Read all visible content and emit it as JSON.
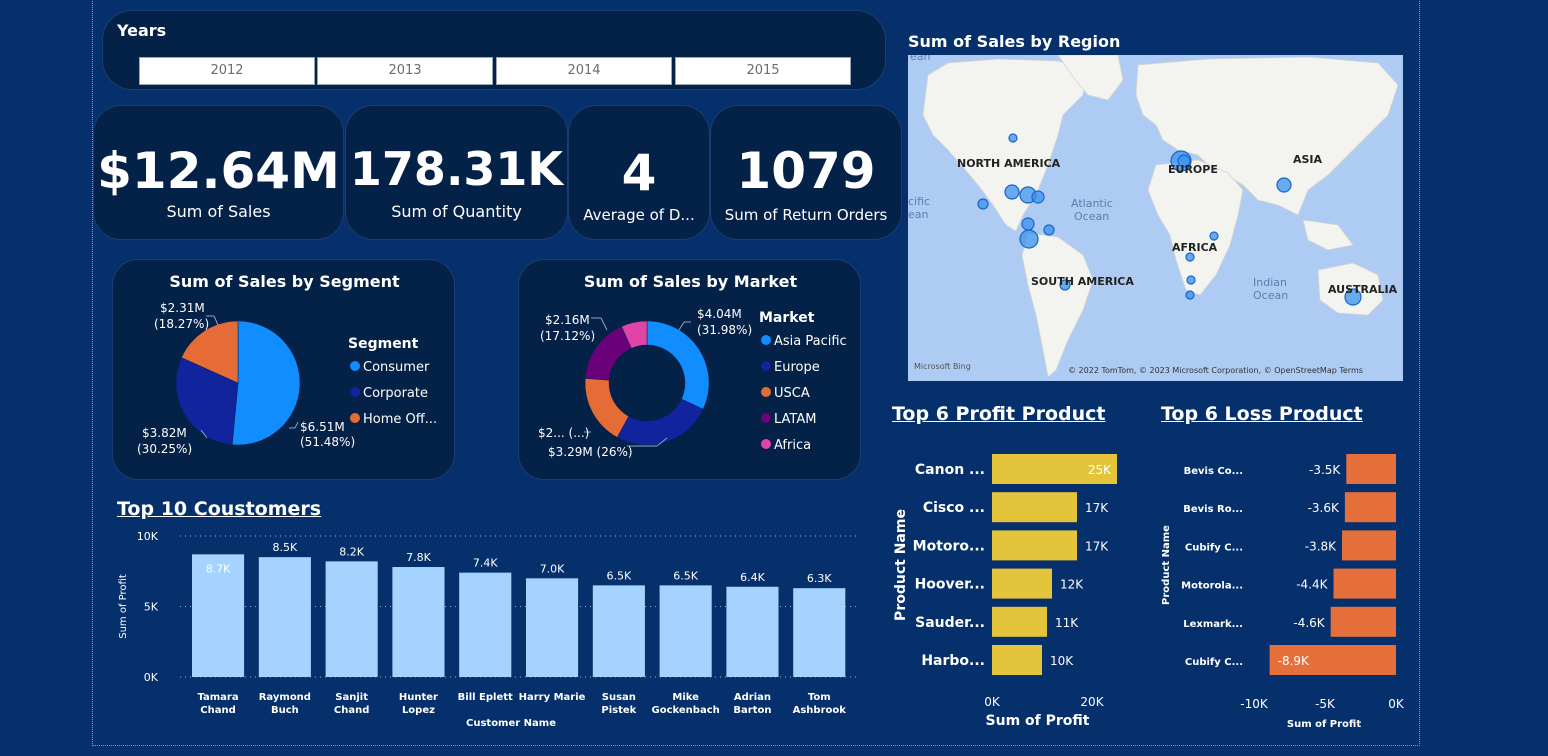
{
  "slicer": {
    "title": "Years",
    "years": [
      "2012",
      "2013",
      "2014",
      "2015"
    ]
  },
  "cards": [
    {
      "value": "$12.64M",
      "label": "Sum of Sales"
    },
    {
      "value": "178.31K",
      "label": "Sum of Quantity"
    },
    {
      "value": "4",
      "label": "Average of D..."
    },
    {
      "value": "1079",
      "label": "Sum of Return Orders"
    }
  ],
  "map": {
    "title": "Sum of Sales by Region",
    "labels": {
      "north_america": "NORTH AMERICA",
      "europe": "EUROPE",
      "asia": "ASIA",
      "africa": "AFRICA",
      "south_america": "SOUTH AMERICA",
      "australia": "AUSTRALIA",
      "atlantic_1": "Atlantic",
      "atlantic_2": "Ocean",
      "indian_1": "Indian",
      "indian_2": "Ocean",
      "pacific_1": "cific",
      "pacific_2": "ean",
      "top_ocean": "ean"
    },
    "bing": "Microsoft Bing",
    "copyright": "© 2022 TomTom, © 2023 Microsoft Corporation, © OpenStreetMap  Terms"
  },
  "colors": {
    "background": "#05306b",
    "panel": "#042147",
    "bar_customers": "#a4d3ff",
    "bar_profit": "#e4c43a",
    "bar_loss": "#e5703c",
    "consumer": "#118dff",
    "corporate": "#12239e",
    "home_office": "#e66c37",
    "asia_pacific": "#118dff",
    "europe": "#12239e",
    "usca": "#e66c37",
    "latam": "#6b007b",
    "africa": "#e044a7"
  },
  "chart_data": [
    {
      "type": "pie",
      "title": "Sum of Sales by Segment",
      "legend_title": "Segment",
      "legend_placement": "right",
      "categories": [
        "Consumer",
        "Corporate",
        "Home Off..."
      ],
      "values": [
        6.51,
        3.82,
        2.31
      ],
      "percent": [
        51.48,
        30.25,
        18.27
      ],
      "labels": [
        {
          "value": "$6.51M",
          "pct": "(51.48%)"
        },
        {
          "value": "$3.82M",
          "pct": "(30.25%)"
        },
        {
          "value": "$2.31M",
          "pct": "(18.27%)"
        }
      ]
    },
    {
      "type": "pie",
      "donut": true,
      "title": "Sum of Sales by Market",
      "legend_title": "Market",
      "legend_placement": "right",
      "categories": [
        "Asia Pacific",
        "Europe",
        "USCA",
        "LATAM",
        "Africa"
      ],
      "values": [
        4.04,
        3.29,
        2.3,
        2.16,
        0.85
      ],
      "percent": [
        31.98,
        26,
        18.2,
        17.12,
        6.7
      ],
      "labels": [
        {
          "text": "$4.04M",
          "pct": "(31.98%)"
        },
        {
          "text": "$3.29M (26%)"
        },
        {
          "text": "$2... (...)"
        },
        {
          "text": "$2.16M",
          "pct": "(17.12%)"
        }
      ]
    },
    {
      "type": "bar",
      "title": "Top 10 Coustomers",
      "xlabel": "Customer Name",
      "ylabel": "Sum of Profit",
      "categories": [
        [
          "Tamara",
          "Chand"
        ],
        [
          "Raymond",
          "Buch"
        ],
        [
          "Sanjit",
          "Chand"
        ],
        [
          "Hunter",
          "Lopez"
        ],
        [
          "Bill Eplett"
        ],
        [
          "Harry Marie"
        ],
        [
          "Susan",
          "Pistek"
        ],
        [
          "Mike",
          "Gockenbach"
        ],
        [
          "Adrian",
          "Barton"
        ],
        [
          "Tom",
          "Ashbrook"
        ]
      ],
      "values": [
        8700,
        8500,
        8200,
        7800,
        7400,
        7000,
        6500,
        6500,
        6400,
        6300
      ],
      "data_labels": [
        "8.7K",
        "8.5K",
        "8.2K",
        "7.8K",
        "7.4K",
        "7.0K",
        "6.5K",
        "6.5K",
        "6.4K",
        "6.3K"
      ],
      "ylim": [
        0,
        10000
      ],
      "yticks": [
        "0K",
        "5K",
        "10K"
      ],
      "grid": true
    },
    {
      "type": "bar",
      "orientation": "horizontal",
      "title": "Top 6 Profit Product",
      "xlabel": "Sum of Profit",
      "ylabel": "Product Name",
      "categories": [
        "Canon ...",
        "Cisco ...",
        "Motoro...",
        "Hoover...",
        "Sauder...",
        "Harbo..."
      ],
      "values": [
        25000,
        17000,
        17000,
        12000,
        11000,
        10000
      ],
      "data_labels": [
        "25K",
        "17K",
        "17K",
        "12K",
        "11K",
        "10K"
      ],
      "xlim": [
        0,
        25000
      ],
      "xticks": [
        "0K",
        "20K"
      ]
    },
    {
      "type": "bar",
      "orientation": "horizontal",
      "title": "Top 6 Loss Product",
      "xlabel": "Sum of Profit",
      "ylabel": "Product Name",
      "categories": [
        "Bevis Co...",
        "Bevis Ro...",
        "Cubify C...",
        "Motorola...",
        "Lexmark...",
        "Cubify C..."
      ],
      "values": [
        -3500,
        -3600,
        -3800,
        -4400,
        -4600,
        -8900
      ],
      "data_labels": [
        "-3.5K",
        "-3.6K",
        "-3.8K",
        "-4.4K",
        "-4.6K",
        "-8.9K"
      ],
      "xlim": [
        -10000,
        0
      ],
      "xticks": [
        "-10K",
        "-5K",
        "0K"
      ]
    }
  ]
}
